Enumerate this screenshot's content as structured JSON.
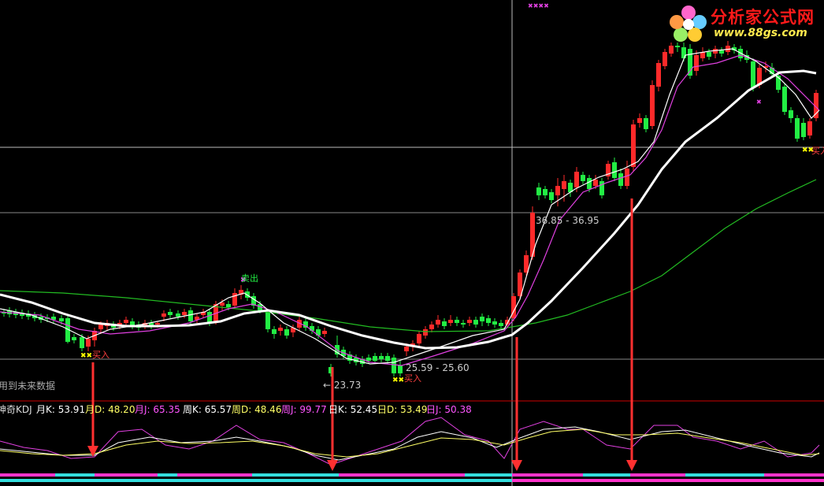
{
  "price_labels": {
    "high_range": "36.85 - 36.95",
    "low_range": "25.59 - 25.60",
    "low_point": "← 23.73",
    "future_note": "用到未来数据"
  },
  "signals": {
    "sell": "卖出",
    "buy": "买入"
  },
  "indicator": {
    "name": "神奇KDJ",
    "month_k": "月K: 53.91",
    "month_d": "月D: 48.20",
    "month_j": "月J: 65.35",
    "week_k": "周K: 65.57",
    "week_d": "周D: 48.46",
    "week_j": "周J: 99.77",
    "day_k": "日K: 52.45",
    "day_d": "日D: 53.49",
    "day_j": "日J: 50.38"
  },
  "logo": {
    "brand": "分析家公式网",
    "url": "www.88gs.com"
  },
  "colors": {
    "up_candle": "#ff2a2a",
    "down_candle": "#22ee44",
    "ma_short": "#ffffff",
    "ma_mid": "#e040e0",
    "ma_long": "#22bb22",
    "kdj_k": "#ffffff",
    "kdj_d": "#ffff66",
    "kdj_j": "#e040e0",
    "arrow": "#ff3030",
    "crosshair": "#cccccc",
    "divider": "#cc0000"
  },
  "chart_data": {
    "type": "candlestick",
    "price_range_shown": [
      23.73,
      36.95
    ],
    "signals": [
      {
        "type": "buy",
        "label": "买入"
      },
      {
        "type": "sell",
        "label": "卖出"
      },
      {
        "type": "buy",
        "label": "买入"
      },
      {
        "type": "buy",
        "label": "买入"
      }
    ],
    "indicator_values": {
      "month_k": 53.91,
      "month_d": 48.2,
      "month_j": 65.35,
      "week_k": 65.57,
      "week_d": 48.46,
      "week_j": 99.77,
      "day_k": 52.45,
      "day_d": 53.49,
      "day_j": 50.38
    }
  }
}
